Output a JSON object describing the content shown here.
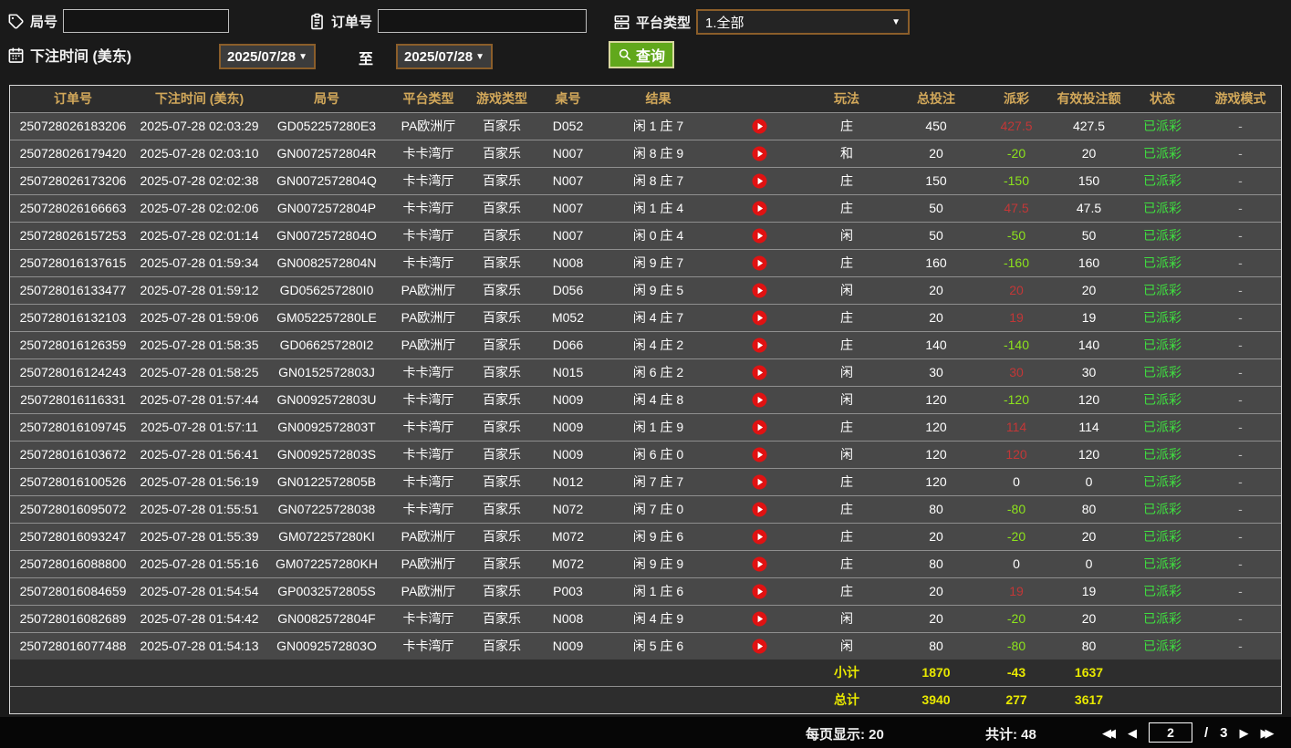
{
  "filters": {
    "round_label": "局号",
    "round_value": "",
    "order_label": "订单号",
    "order_value": "",
    "platform_label": "平台类型",
    "platform_value": "1.全部",
    "bet_time_label": "下注时间 (美东)",
    "date_from": "2025/07/28",
    "to_label": "至",
    "date_to": "2025/07/28",
    "query_label": "查询",
    "caret": "▼"
  },
  "icons": {
    "round": "tag-icon",
    "order": "clipboard-icon",
    "platform": "server-icon",
    "bet_time": "calendar-icon",
    "query": "search-icon",
    "row_video": "play-icon"
  },
  "colors": {
    "header_text": "#d2a85a",
    "header_bg": "#2d2d2d",
    "row_bg": "#484848",
    "win_red": "#c23737",
    "loss_green": "#8ce21c",
    "status_green": "#3fdf3f",
    "totals_yellow": "#e8e800",
    "query_green": "#61a81c",
    "brown_border": "#8b5e2a",
    "play_red": "#e01212"
  },
  "table": {
    "headers": [
      "订单号",
      "下注时间 (美东)",
      "局号",
      "平台类型",
      "游戏类型",
      "桌号",
      "结果",
      "",
      "玩法",
      "总投注",
      "派彩",
      "有效投注额",
      "状态",
      "游戏模式"
    ],
    "rows": [
      {
        "order": "250728026183206",
        "time": "2025-07-28 02:03:29",
        "round": "GD052257280E3",
        "platform": "PA欧洲厅",
        "game": "百家乐",
        "table": "D052",
        "result": "闲 1 庄 7",
        "play_method": "庄",
        "bet": "450",
        "payout": "427.5",
        "payout_class": "win",
        "valid": "427.5",
        "status": "已派彩",
        "mode": "-"
      },
      {
        "order": "250728026179420",
        "time": "2025-07-28 02:03:10",
        "round": "GN0072572804R",
        "platform": "卡卡湾厅",
        "game": "百家乐",
        "table": "N007",
        "result": "闲 8 庄 9",
        "play_method": "和",
        "bet": "20",
        "payout": "-20",
        "payout_class": "loss",
        "valid": "20",
        "status": "已派彩",
        "mode": "-"
      },
      {
        "order": "250728026173206",
        "time": "2025-07-28 02:02:38",
        "round": "GN0072572804Q",
        "platform": "卡卡湾厅",
        "game": "百家乐",
        "table": "N007",
        "result": "闲 8 庄 7",
        "play_method": "庄",
        "bet": "150",
        "payout": "-150",
        "payout_class": "loss",
        "valid": "150",
        "status": "已派彩",
        "mode": "-"
      },
      {
        "order": "250728026166663",
        "time": "2025-07-28 02:02:06",
        "round": "GN0072572804P",
        "platform": "卡卡湾厅",
        "game": "百家乐",
        "table": "N007",
        "result": "闲 1 庄 4",
        "play_method": "庄",
        "bet": "50",
        "payout": "47.5",
        "payout_class": "win",
        "valid": "47.5",
        "status": "已派彩",
        "mode": "-"
      },
      {
        "order": "250728026157253",
        "time": "2025-07-28 02:01:14",
        "round": "GN0072572804O",
        "platform": "卡卡湾厅",
        "game": "百家乐",
        "table": "N007",
        "result": "闲 0 庄 4",
        "play_method": "闲",
        "bet": "50",
        "payout": "-50",
        "payout_class": "loss",
        "valid": "50",
        "status": "已派彩",
        "mode": "-"
      },
      {
        "order": "250728016137615",
        "time": "2025-07-28 01:59:34",
        "round": "GN0082572804N",
        "platform": "卡卡湾厅",
        "game": "百家乐",
        "table": "N008",
        "result": "闲 9 庄 7",
        "play_method": "庄",
        "bet": "160",
        "payout": "-160",
        "payout_class": "loss",
        "valid": "160",
        "status": "已派彩",
        "mode": "-"
      },
      {
        "order": "250728016133477",
        "time": "2025-07-28 01:59:12",
        "round": "GD056257280I0",
        "platform": "PA欧洲厅",
        "game": "百家乐",
        "table": "D056",
        "result": "闲 9 庄 5",
        "play_method": "闲",
        "bet": "20",
        "payout": "20",
        "payout_class": "win",
        "valid": "20",
        "status": "已派彩",
        "mode": "-"
      },
      {
        "order": "250728016132103",
        "time": "2025-07-28 01:59:06",
        "round": "GM052257280LE",
        "platform": "PA欧洲厅",
        "game": "百家乐",
        "table": "M052",
        "result": "闲 4 庄 7",
        "play_method": "庄",
        "bet": "20",
        "payout": "19",
        "payout_class": "win",
        "valid": "19",
        "status": "已派彩",
        "mode": "-"
      },
      {
        "order": "250728016126359",
        "time": "2025-07-28 01:58:35",
        "round": "GD066257280I2",
        "platform": "PA欧洲厅",
        "game": "百家乐",
        "table": "D066",
        "result": "闲 4 庄 2",
        "play_method": "庄",
        "bet": "140",
        "payout": "-140",
        "payout_class": "loss",
        "valid": "140",
        "status": "已派彩",
        "mode": "-"
      },
      {
        "order": "250728016124243",
        "time": "2025-07-28 01:58:25",
        "round": "GN0152572803J",
        "platform": "卡卡湾厅",
        "game": "百家乐",
        "table": "N015",
        "result": "闲 6 庄 2",
        "play_method": "闲",
        "bet": "30",
        "payout": "30",
        "payout_class": "win",
        "valid": "30",
        "status": "已派彩",
        "mode": "-"
      },
      {
        "order": "250728016116331",
        "time": "2025-07-28 01:57:44",
        "round": "GN0092572803U",
        "platform": "卡卡湾厅",
        "game": "百家乐",
        "table": "N009",
        "result": "闲 4 庄 8",
        "play_method": "闲",
        "bet": "120",
        "payout": "-120",
        "payout_class": "loss",
        "valid": "120",
        "status": "已派彩",
        "mode": "-"
      },
      {
        "order": "250728016109745",
        "time": "2025-07-28 01:57:11",
        "round": "GN0092572803T",
        "platform": "卡卡湾厅",
        "game": "百家乐",
        "table": "N009",
        "result": "闲 1 庄 9",
        "play_method": "庄",
        "bet": "120",
        "payout": "114",
        "payout_class": "win",
        "valid": "114",
        "status": "已派彩",
        "mode": "-"
      },
      {
        "order": "250728016103672",
        "time": "2025-07-28 01:56:41",
        "round": "GN0092572803S",
        "platform": "卡卡湾厅",
        "game": "百家乐",
        "table": "N009",
        "result": "闲 6 庄 0",
        "play_method": "闲",
        "bet": "120",
        "payout": "120",
        "payout_class": "win",
        "valid": "120",
        "status": "已派彩",
        "mode": "-"
      },
      {
        "order": "250728016100526",
        "time": "2025-07-28 01:56:19",
        "round": "GN0122572805B",
        "platform": "卡卡湾厅",
        "game": "百家乐",
        "table": "N012",
        "result": "闲 7 庄 7",
        "play_method": "庄",
        "bet": "120",
        "payout": "0",
        "payout_class": "zero",
        "valid": "0",
        "status": "已派彩",
        "mode": "-"
      },
      {
        "order": "250728016095072",
        "time": "2025-07-28 01:55:51",
        "round": "GN07225728038",
        "platform": "卡卡湾厅",
        "game": "百家乐",
        "table": "N072",
        "result": "闲 7 庄 0",
        "play_method": "庄",
        "bet": "80",
        "payout": "-80",
        "payout_class": "loss",
        "valid": "80",
        "status": "已派彩",
        "mode": "-"
      },
      {
        "order": "250728016093247",
        "time": "2025-07-28 01:55:39",
        "round": "GM072257280KI",
        "platform": "PA欧洲厅",
        "game": "百家乐",
        "table": "M072",
        "result": "闲 9 庄 6",
        "play_method": "庄",
        "bet": "20",
        "payout": "-20",
        "payout_class": "loss",
        "valid": "20",
        "status": "已派彩",
        "mode": "-"
      },
      {
        "order": "250728016088800",
        "time": "2025-07-28 01:55:16",
        "round": "GM072257280KH",
        "platform": "PA欧洲厅",
        "game": "百家乐",
        "table": "M072",
        "result": "闲 9 庄 9",
        "play_method": "庄",
        "bet": "80",
        "payout": "0",
        "payout_class": "zero",
        "valid": "0",
        "status": "已派彩",
        "mode": "-"
      },
      {
        "order": "250728016084659",
        "time": "2025-07-28 01:54:54",
        "round": "GP0032572805S",
        "platform": "PA欧洲厅",
        "game": "百家乐",
        "table": "P003",
        "result": "闲 1 庄 6",
        "play_method": "庄",
        "bet": "20",
        "payout": "19",
        "payout_class": "win",
        "valid": "19",
        "status": "已派彩",
        "mode": "-"
      },
      {
        "order": "250728016082689",
        "time": "2025-07-28 01:54:42",
        "round": "GN0082572804F",
        "platform": "卡卡湾厅",
        "game": "百家乐",
        "table": "N008",
        "result": "闲 4 庄 9",
        "play_method": "闲",
        "bet": "20",
        "payout": "-20",
        "payout_class": "loss",
        "valid": "20",
        "status": "已派彩",
        "mode": "-"
      },
      {
        "order": "250728016077488",
        "time": "2025-07-28 01:54:13",
        "round": "GN0092572803O",
        "platform": "卡卡湾厅",
        "game": "百家乐",
        "table": "N009",
        "result": "闲 5 庄 6",
        "play_method": "闲",
        "bet": "80",
        "payout": "-80",
        "payout_class": "loss",
        "valid": "80",
        "status": "已派彩",
        "mode": "-"
      }
    ],
    "subtotal": {
      "label": "小计",
      "bet": "1870",
      "payout": "-43",
      "valid": "1637"
    },
    "total": {
      "label": "总计",
      "bet": "3940",
      "payout": "277",
      "valid": "3617"
    }
  },
  "pagination": {
    "per_page": "每页显示: 20",
    "grand_count": "共计: 48",
    "first_icon": "◀◀",
    "prev_icon": "◀",
    "current_page": "2",
    "separator": "/",
    "total_pages": "3",
    "next_icon": "▶",
    "last_icon": "▶▶"
  }
}
